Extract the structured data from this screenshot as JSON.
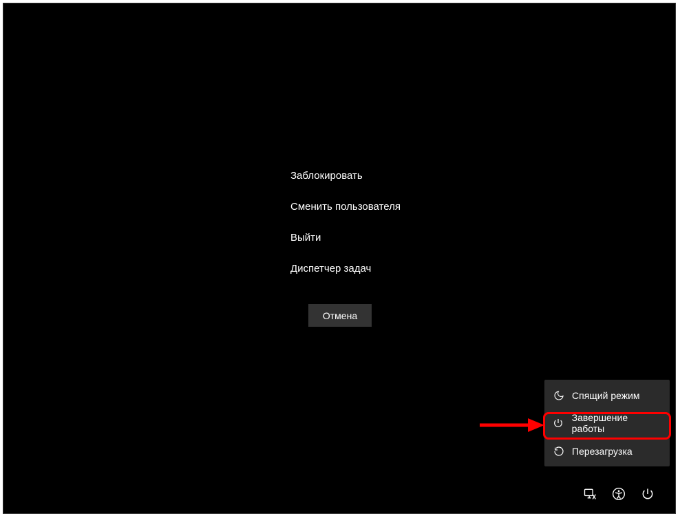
{
  "menu": {
    "lock": "Заблокировать",
    "switch_user": "Сменить пользователя",
    "sign_out": "Выйти",
    "task_manager": "Диспетчер задач",
    "cancel": "Отмена"
  },
  "power_menu": {
    "sleep": "Спящий режим",
    "shutdown": "Завершение работы",
    "restart": "Перезагрузка"
  },
  "annotation": {
    "highlighted_item": "shutdown"
  }
}
